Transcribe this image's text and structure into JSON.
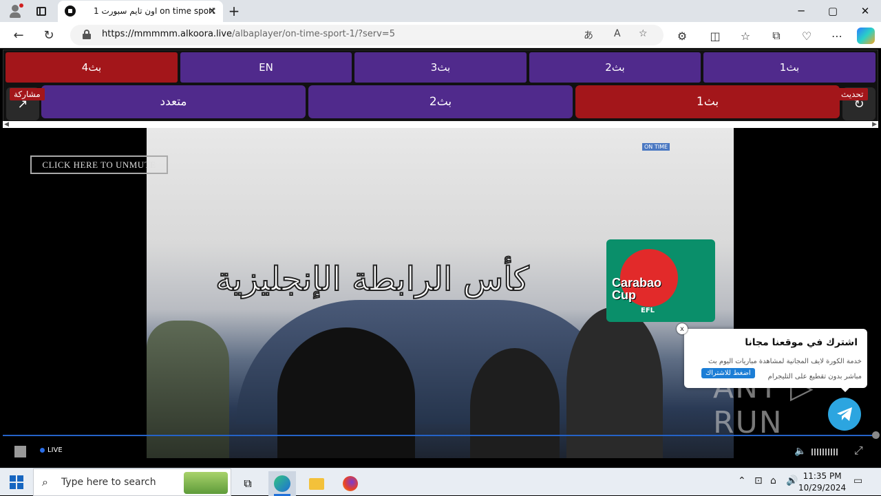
{
  "browser": {
    "tab_title": "اون تايم سبورت 1 on time sport",
    "url_host": "https://mmmmm.alkoora.live",
    "url_path": "/albaplayer/on-time-sport-1/?serv=5",
    "new_tab": "+",
    "minimize": "─",
    "maximize": "▢",
    "close": "✕"
  },
  "servers_top": [
    {
      "label": "بث4",
      "state": "active"
    },
    {
      "label": "EN",
      "state": "normal"
    },
    {
      "label": "بث3",
      "state": "normal"
    },
    {
      "label": "بث2",
      "state": "normal"
    },
    {
      "label": "بث1",
      "state": "normal"
    }
  ],
  "servers_bottom": [
    {
      "label": "متعدد",
      "state": "normal"
    },
    {
      "label": "بث2",
      "state": "normal"
    },
    {
      "label": "بث1",
      "state": "active"
    }
  ],
  "share_label": "مشاركة",
  "refresh_label": "تحديث",
  "player": {
    "unmute_label": "CLICK HERE TO UNMUTE",
    "overlay_title": "كأس الرابطة الإنجليزية",
    "cup_text_line1": "Carabao",
    "cup_text_line2": "Cup",
    "efl": "EFL",
    "channel_logo": "ON TIME",
    "live_label": "LIVE",
    "watermark": "ANY ▷ RUN"
  },
  "popup": {
    "title": "اشترك في موقعنا مجانا",
    "desc": "خدمة الكورة لايف المجانية لمشاهدة مباريات اليوم بث مباشر بدون تقطيع على التليجرام",
    "button": "اضغط للاشتراك",
    "close": "x"
  },
  "taskbar": {
    "search_placeholder": "Type here to search",
    "time": "11:35 PM",
    "date": "10/29/2024"
  },
  "colors": {
    "purple": "#502a8c",
    "red": "#a3161a",
    "telegram": "#2ca5e0",
    "progress": "#2563c8"
  }
}
